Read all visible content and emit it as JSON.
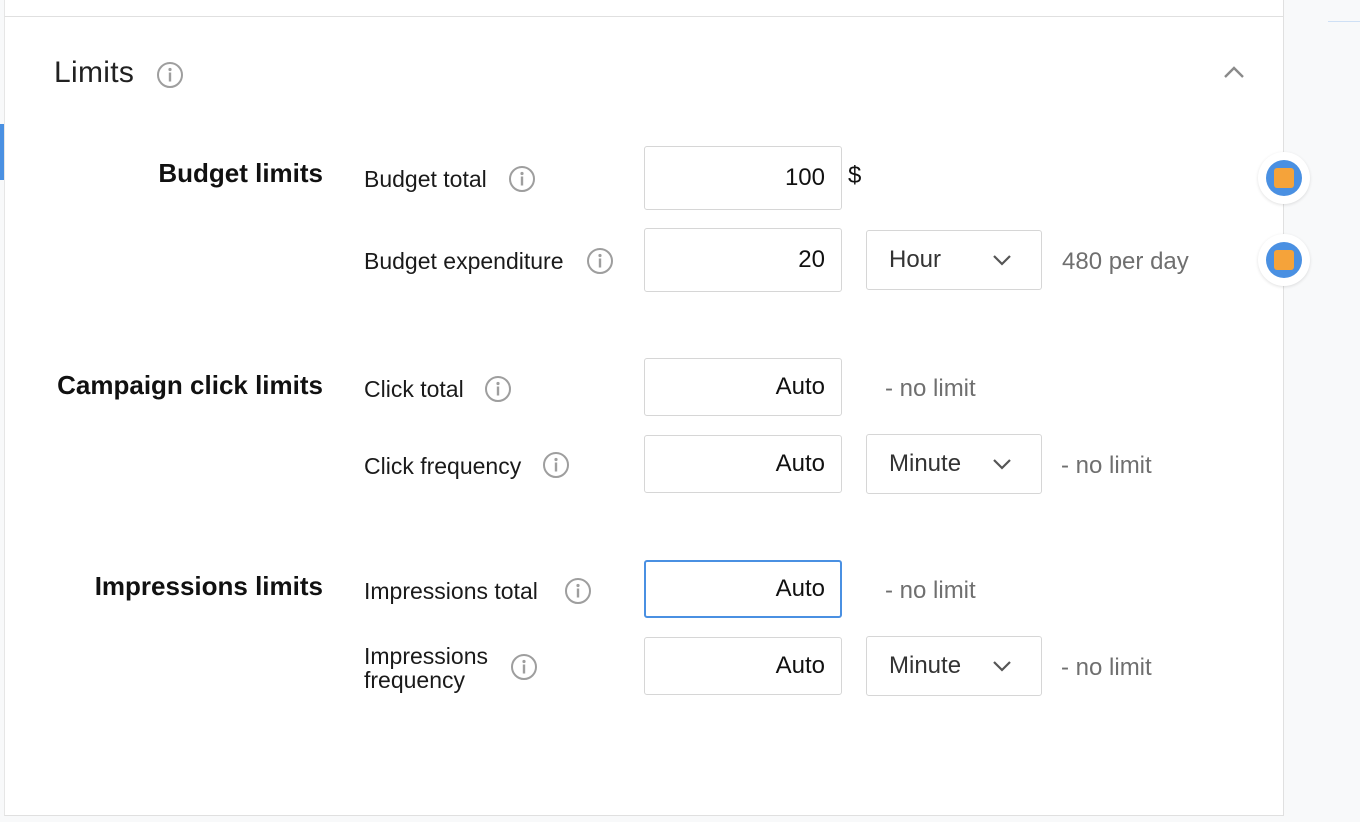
{
  "section": {
    "title": "Limits",
    "info_icon": "info-icon",
    "collapse_icon": "chevron-up-icon"
  },
  "groups": {
    "budget": {
      "label": "Budget limits",
      "total": {
        "label": "Budget total",
        "value": "100",
        "currency": "$"
      },
      "expenditure": {
        "label": "Budget expenditure",
        "value": "20",
        "period": "Hour",
        "hint": "480 per day"
      }
    },
    "clicks": {
      "label": "Campaign click limits",
      "total": {
        "label": "Click total",
        "value": "Auto",
        "hint": "- no limit"
      },
      "frequency": {
        "label": "Click frequency",
        "value": "Auto",
        "period": "Minute",
        "hint": "- no limit"
      }
    },
    "impressions": {
      "label": "Impressions limits",
      "total": {
        "label": "Impressions total",
        "value": "Auto",
        "hint": "- no limit"
      },
      "frequency": {
        "label_line1": "Impressions",
        "label_line2": "frequency",
        "value": "Auto",
        "period": "Minute",
        "hint": "- no limit"
      }
    }
  },
  "colors": {
    "accent": "#4a90e2",
    "handle_square": "#f5a33a",
    "hint_text": "#6f6f6f"
  }
}
